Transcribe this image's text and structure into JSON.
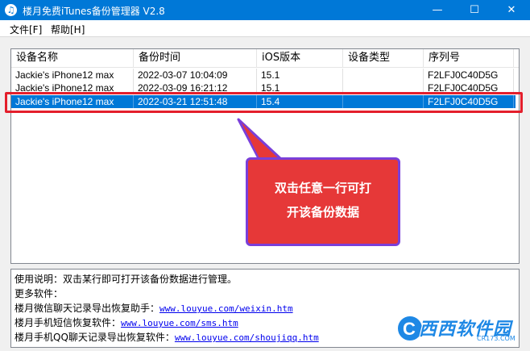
{
  "window": {
    "title": "楼月免费iTunes备份管理器 V2.8",
    "minimize": "—",
    "maximize": "☐",
    "close": "✕"
  },
  "menu": {
    "file": "文件[F]",
    "help": "帮助[H]"
  },
  "table": {
    "columns": [
      "设备名称",
      "备份时间",
      "iOS版本",
      "设备类型",
      "序列号"
    ],
    "rows": [
      {
        "device": "Jackie's iPhone12 max",
        "time": "2022-03-07 10:04:09",
        "ios": "15.1",
        "type": "",
        "serial": "F2LFJ0C40D5G"
      },
      {
        "device": "Jackie's iPhone12 max",
        "time": "2022-03-09 16:21:12",
        "ios": "15.1",
        "type": "",
        "serial": "F2LFJ0C40D5G"
      },
      {
        "device": "Jackie's iPhone12 max",
        "time": "2022-03-21 12:51:48",
        "ios": "15.4",
        "type": "",
        "serial": "F2LFJ0C40D5G"
      }
    ],
    "selected_row": 2
  },
  "callout": {
    "line1": "双击任意一行可打",
    "line2": "开该备份数据"
  },
  "info": {
    "usage": "使用说明：双击某行即可打开该备份数据进行管理。",
    "more": "更多软件：",
    "items": [
      {
        "label": "楼月微信聊天记录导出恢复助手：",
        "url": "www.louyue.com/weixin.htm"
      },
      {
        "label": "楼月手机短信恢复软件：",
        "url": "www.louyue.com/sms.htm"
      },
      {
        "label": "楼月手机QQ聊天记录导出恢复软件：",
        "url": "www.louyue.com/shoujiqq.htm"
      }
    ]
  },
  "watermark": {
    "brand": "西西软件园",
    "site": "CR173.COM"
  },
  "colors": {
    "titlebar": "#0078d7",
    "selection": "#0078d7",
    "callout": "#e63838",
    "callout_border": "#7a3fd9",
    "highlight_box": "#e41f2c"
  }
}
